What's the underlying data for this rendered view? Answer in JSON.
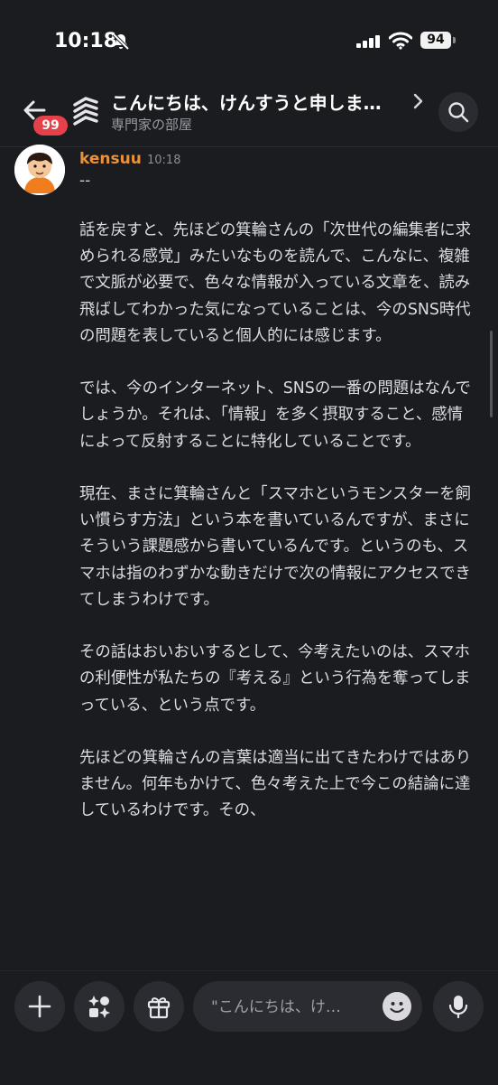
{
  "status_bar": {
    "time": "10:18",
    "battery": "94"
  },
  "header": {
    "unread_badge": "99",
    "title": "こんにちは、けんすうと申しま…",
    "subtitle": "専門家の部屋"
  },
  "message": {
    "author": "kensuu",
    "timestamp": "10:18",
    "separator": "--",
    "paragraphs": [
      "話を戻すと、先ほどの箕輪さんの「次世代の編集者に求められる感覚」みたいなものを読んで、こんなに、複雑で文脈が必要で、色々な情報が入っている文章を、読み飛ばしてわかった気になっていることは、今のSNS時代の問題を表していると個人的には感じます。",
      "では、今のインターネット、SNSの一番の問題はなんでしょうか。それは、「情報」を多く摂取すること、感情によって反射することに特化していることです。",
      "現在、まさに箕輪さんと「スマホというモンスターを飼い慣らす方法」という本を書いているんですが、まさにそういう課題感から書いているんです。というのも、スマホは指のわずかな動きだけで次の情報にアクセスできてしまうわけです。",
      "その話はおいおいするとして、今考えたいのは、スマホの利便性が私たちの『考える』という行為を奪ってしまっている、という点です。",
      "先ほどの箕輪さんの言葉は適当に出てきたわけではありません。何年もかけて、色々考えた上で今この結論に達しているわけです。その、"
    ]
  },
  "composer": {
    "placeholder": "\"こんにちは、け…"
  },
  "colors": {
    "background": "#1b1c20",
    "author": "#e8923f",
    "badge": "#e5414a",
    "control_bg": "#2b2c32"
  },
  "icons": [
    "bell-slash-icon",
    "cellular-signal-icon",
    "wifi-icon",
    "back-arrow-icon",
    "channel-icon",
    "chevron-right-icon",
    "search-icon",
    "plus-icon",
    "apps-icon",
    "gift-icon",
    "emoji-icon",
    "microphone-icon"
  ]
}
